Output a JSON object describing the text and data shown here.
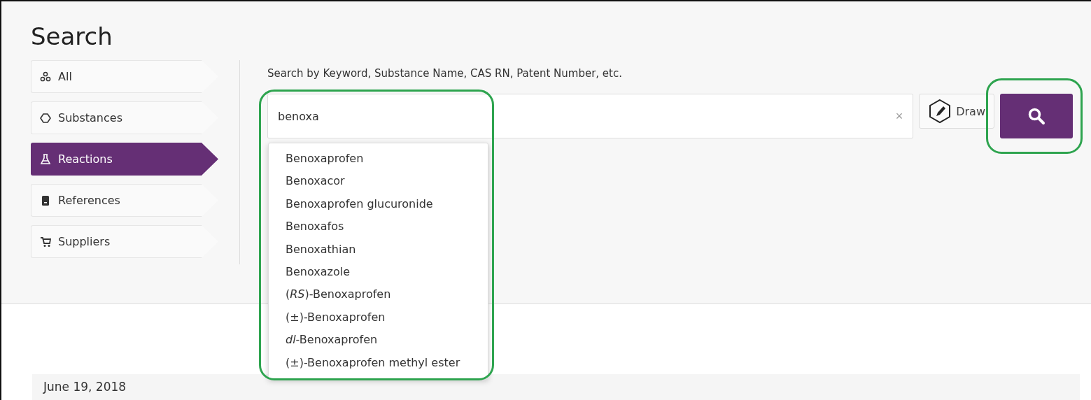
{
  "title": "Search",
  "sidebar": {
    "items": [
      {
        "label": "All",
        "selected": false
      },
      {
        "label": "Substances",
        "selected": false
      },
      {
        "label": "Reactions",
        "selected": true
      },
      {
        "label": "References",
        "selected": false
      },
      {
        "label": "Suppliers",
        "selected": false
      }
    ]
  },
  "search": {
    "hint": "Search by Keyword, Substance Name, CAS RN, Patent Number, etc.",
    "value": "benoxa",
    "highlighted": true,
    "clear": "×",
    "draw_button": "Draw",
    "search_button_highlighted": true
  },
  "suggestions": [
    "Benoxaprofen",
    "Benoxacor",
    "Benoxaprofen glucuronide",
    "Benoxafos",
    "Benoxathian",
    "Benoxazole",
    "(*RS*)-Benoxaprofen",
    "(±)-Benoxaprofen",
    "*dl*-Benoxaprofen",
    "(±)-Benoxaprofen methyl ester"
  ],
  "recent": {
    "date": "June 19, 2018"
  }
}
